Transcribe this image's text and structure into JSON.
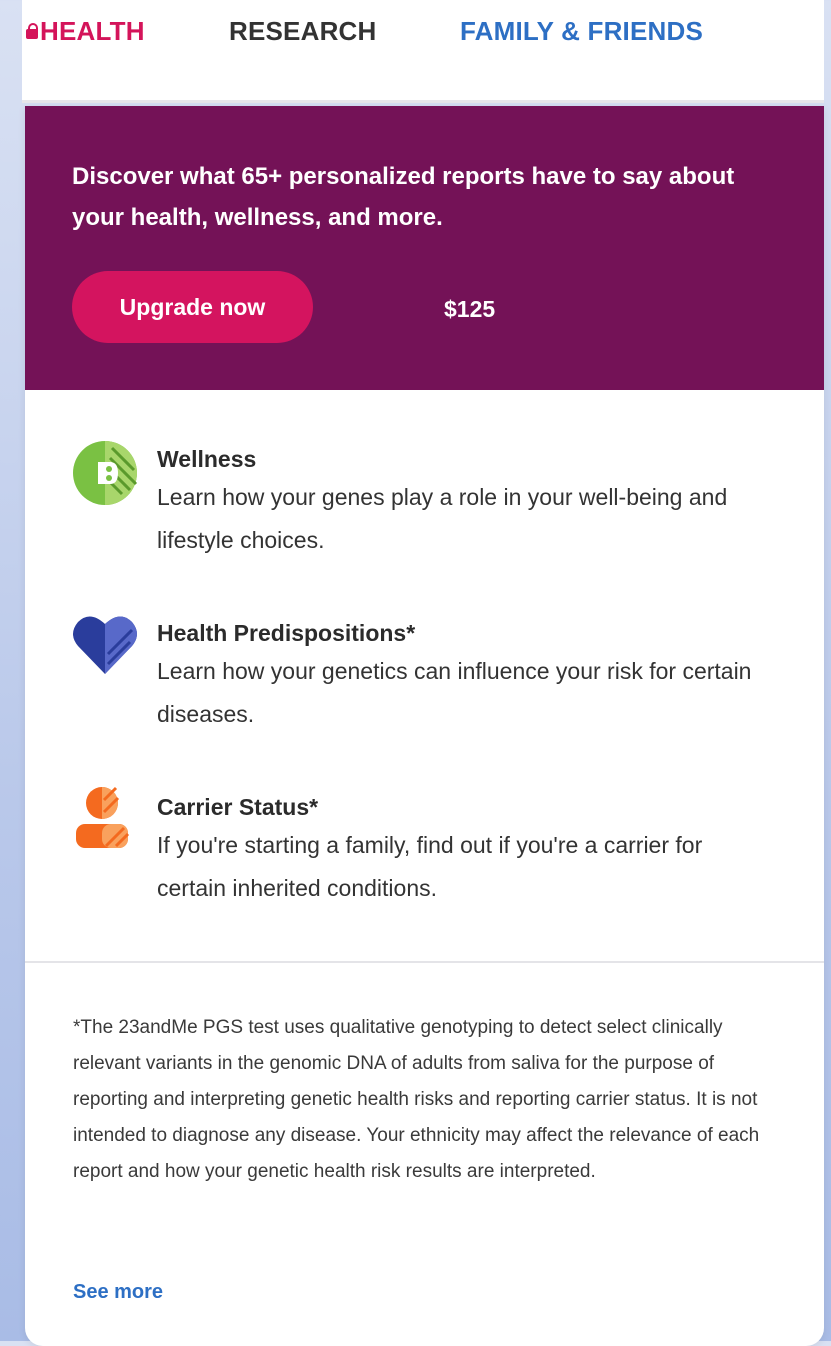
{
  "tabs": {
    "health": "HEALTH",
    "research": "RESEARCH",
    "family": "FAMILY & FRIENDS"
  },
  "banner": {
    "headline": "Discover what 65+ personalized reports have to say about your health, wellness, and more.",
    "button_label": "Upgrade now",
    "price": "$125"
  },
  "features": [
    {
      "title": "Wellness",
      "description": "Learn how your genes play a role in your well-being and lifestyle choices.",
      "icon": "wellness-icon"
    },
    {
      "title": "Health Predispositions*",
      "description": "Learn how your genetics can influence your risk for certain diseases.",
      "icon": "heart-icon"
    },
    {
      "title": "Carrier Status*",
      "description": "If you're starting a family, find out if you're a carrier for certain inherited conditions.",
      "icon": "person-icon"
    }
  ],
  "disclaimer": "*The 23andMe PGS test uses qualitative genotyping to detect select clinically relevant variants in the genomic DNA of adults from saliva for the purpose of reporting and interpreting genetic health risks and reporting carrier status. It is not intended to diagnose any disease. Your ethnicity may affect the relevance of each report and how your genetic health risk results are interpreted.",
  "see_more": "See more",
  "colors": {
    "banner": "#741257",
    "accent_pink": "#d4145a",
    "link_blue": "#2d6fc4",
    "wellness_green": "#7ac143",
    "heart_blue": "#2a3d9c",
    "carrier_orange": "#f46a1f"
  }
}
